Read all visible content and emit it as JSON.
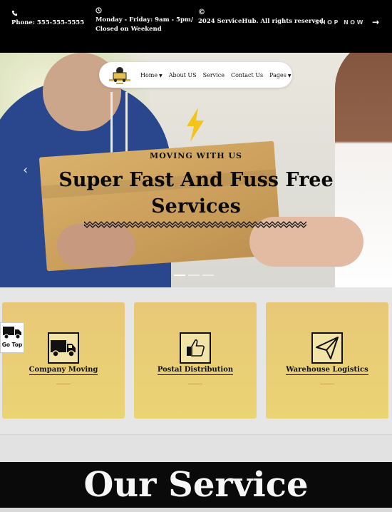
{
  "topbar": {
    "phone": "Phone: 555-555-5555",
    "hours_line1": "Monday - Friday: 9am - 5pm/",
    "hours_line2": "Closed on Weekend",
    "copyright_symbol": "©",
    "copyright_text": "2024 ServiceHub. All rights reserved.",
    "shop_label": "SHOP NOW",
    "shop_arrow": "→"
  },
  "nav": {
    "items": [
      {
        "label": "Home",
        "dropdown": true
      },
      {
        "label": "About US",
        "dropdown": false
      },
      {
        "label": "Service",
        "dropdown": false
      },
      {
        "label": "Contact Us",
        "dropdown": false
      },
      {
        "label": "Pages",
        "dropdown": true
      }
    ]
  },
  "hero": {
    "kicker": "MOVING WITH US",
    "headline": "Super Fast And Fuss Free Services",
    "prev_arrow": "‹",
    "accent_color": "#f2c518"
  },
  "services": [
    {
      "title": "Company Moving",
      "icon": "truck-icon"
    },
    {
      "title": "Postal Distribution",
      "icon": "thumbs-up-icon"
    },
    {
      "title": "Warehouse Logistics",
      "icon": "paper-plane-icon"
    }
  ],
  "gotop": {
    "label": "Go Top",
    "icon": "truck-icon"
  },
  "section": {
    "title": "Our Service"
  }
}
